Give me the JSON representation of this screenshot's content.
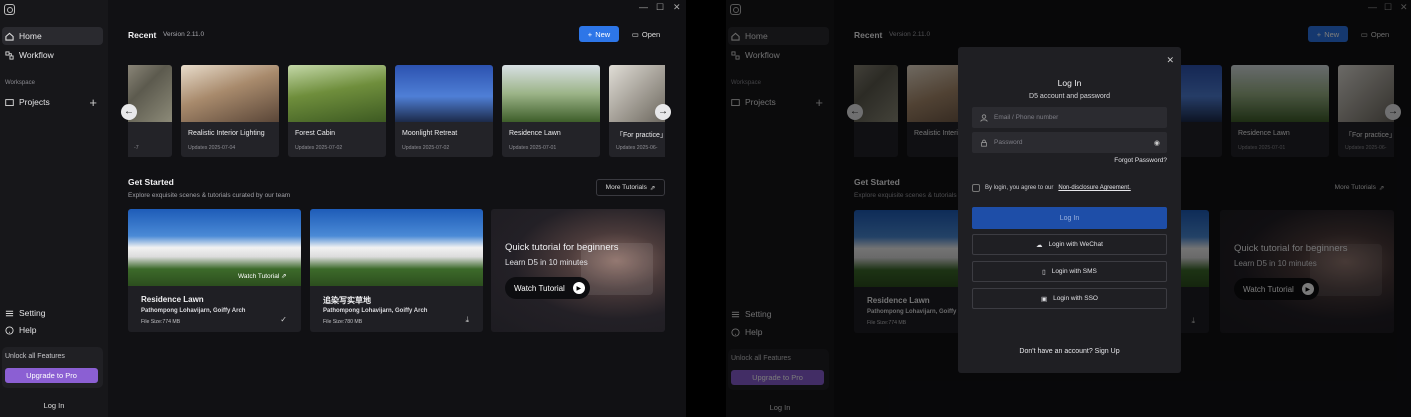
{
  "sidebar": {
    "home": "Home",
    "workflow": "Workflow",
    "workspace": "Workspace",
    "projects": "Projects",
    "setting": "Setting",
    "help": "Help",
    "unlock": "Unlock all Features",
    "upgrade": "Upgrade to Pro",
    "login": "Log In"
  },
  "header": {
    "recent": "Recent",
    "version": "Version 2.11.0",
    "new_label": "New",
    "open_label": "Open"
  },
  "recent_cards": [
    {
      "name": "",
      "updated": "-7"
    },
    {
      "name": "Realistic Interior Lighting",
      "updated": "Updates 2025-07-04"
    },
    {
      "name": "Forest Cabin",
      "updated": "Updates 2025-07-02"
    },
    {
      "name": "Moonlight Retreat",
      "updated": "Updates 2025-07-02"
    },
    {
      "name": "Residence Lawn",
      "updated": "Updates 2025-07-01"
    },
    {
      "name": "「For practice」",
      "updated": "Updates 2025-06-"
    }
  ],
  "get_started": {
    "title": "Get Started",
    "subtitle": "Explore exquisite scenes & tutorials curated by our team",
    "more": "More Tutorials"
  },
  "tutorials": [
    {
      "title": "Residence Lawn",
      "authors": "Pathompong Lohavijarn, Goiffy Arch",
      "size": "File Size:774 MB",
      "watch": "Watch Tutorial"
    },
    {
      "title": "追染写实草地",
      "authors": "Pathompong Lohavijarn, Goiffy Arch",
      "size": "File Size:780 MB"
    }
  ],
  "quick": {
    "title": "Quick tutorial for beginners",
    "subtitle": "Learn D5 in 10 minutes",
    "button": "Watch Tutorial"
  },
  "modal": {
    "title": "Log In",
    "subtitle": "D5 account and password",
    "email_placeholder": "Email / Phone number",
    "password_placeholder": "Password",
    "forgot": "Forgot Password?",
    "agree": "By login, you agree to our",
    "nda": "Non-disclosure Agreement.",
    "login_button": "Log In",
    "wechat": "Login with WeChat",
    "sms": "Login with SMS",
    "sso": "Login with SSO",
    "signup": "Don't have an account? Sign Up"
  },
  "colors": {
    "accent": "#2d76e8",
    "upgrade": "#8b5fd3",
    "background": "#111114"
  }
}
